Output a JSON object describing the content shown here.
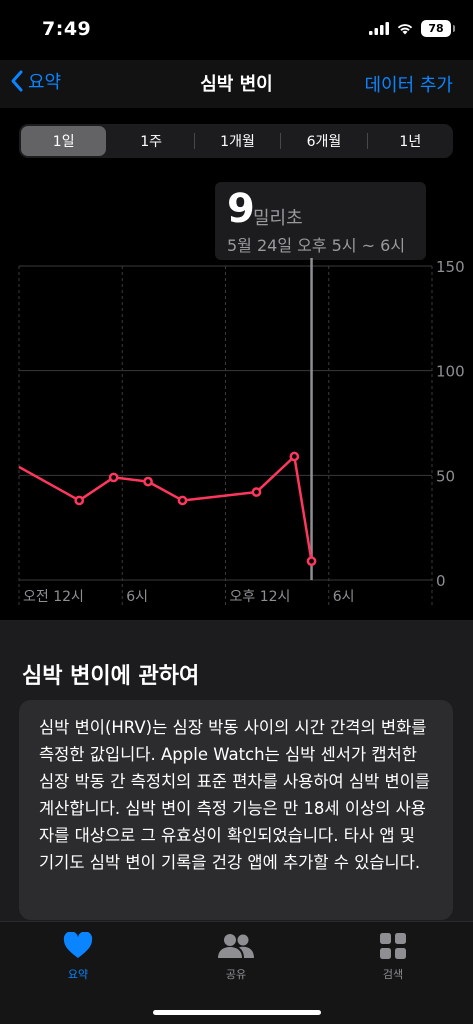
{
  "status": {
    "time": "7:49",
    "battery": "78"
  },
  "nav": {
    "back_label": "요약",
    "title": "심박 변이",
    "action_label": "데이터 추가"
  },
  "segments": [
    {
      "label": "1일",
      "selected": true
    },
    {
      "label": "1주",
      "selected": false
    },
    {
      "label": "1개월",
      "selected": false
    },
    {
      "label": "6개월",
      "selected": false
    },
    {
      "label": "1년",
      "selected": false
    }
  ],
  "tooltip": {
    "value": "9",
    "unit": "밀리초",
    "range": "5월 24일 오후 5시 ~ 6시"
  },
  "colors": {
    "accent": "#0a84ff",
    "line": "#ff375f",
    "background": "#000000",
    "card": "#2c2c2e"
  },
  "chart_data": {
    "type": "line",
    "x": [
      -0.3,
      3.5,
      5.5,
      7.5,
      9.5,
      13.8,
      16.0,
      17.0
    ],
    "x_unit": "hour of day",
    "values": [
      54,
      38,
      49,
      47,
      38,
      42,
      59,
      9
    ],
    "ylim": [
      0,
      150
    ],
    "yticks": [
      "150",
      "100",
      "50",
      "0"
    ],
    "ytick_values": [
      150,
      100,
      50,
      0
    ],
    "xtick_labels": [
      "오전 12시",
      "6시",
      "오후 12시",
      "6시"
    ],
    "xtick_hours": [
      0,
      6,
      12,
      18
    ],
    "selected_hour": 17.0,
    "grid": true
  },
  "about": {
    "heading": "심박 변이에 관하여",
    "body": "심박 변이(HRV)는 심장 박동 사이의 시간 간격의 변화를 측정한 값입니다. Apple Watch는 심박 센서가 캡처한 심장 박동 간 측정치의 표준 편차를 사용하여 심박 변이를 계산합니다. 심박 변이 측정 기능은 만 18세 이상의 사용자를 대상으로 그 유효성이 확인되었습니다. 타사 앱 및 기기도 심박 변이 기록을 건강 앱에 추가할 수 있습니다."
  },
  "tabs": [
    {
      "label": "요약",
      "icon": "heart-icon",
      "selected": true
    },
    {
      "label": "공유",
      "icon": "people-icon",
      "selected": false
    },
    {
      "label": "검색",
      "icon": "grid-icon",
      "selected": false
    }
  ]
}
